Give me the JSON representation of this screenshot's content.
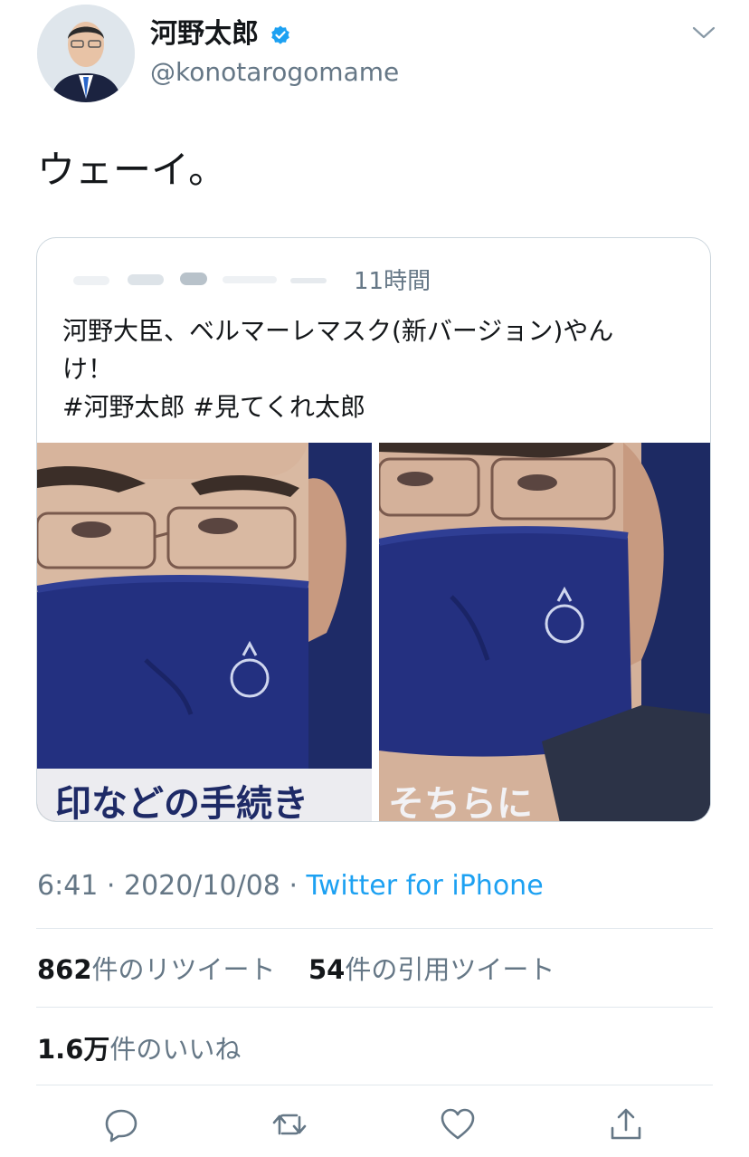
{
  "author": {
    "display_name": "河野太郎",
    "handle": "@konotarogomame",
    "verified": true,
    "avatar_icon": "profile-photo"
  },
  "tweet": {
    "text": "ウェーイ。"
  },
  "quoted_tweet": {
    "time": "11時間",
    "lines": [
      "河野大臣、ベルマーレマスク(新バージョン)やん",
      "け！",
      "#河野太郎 #見てくれ太郎"
    ],
    "images": [
      {
        "caption_overlay": "印などの手続き"
      },
      {
        "caption_overlay": "そちらに"
      }
    ]
  },
  "meta": {
    "time": "6:41",
    "separator": " · ",
    "date": "2020/10/08",
    "source": "Twitter for iPhone"
  },
  "stats": {
    "retweets_count": "862",
    "retweets_label": "件のリツイート",
    "quotes_count": "54",
    "quotes_label": "件の引用ツイート",
    "likes_count": "1.6万",
    "likes_label": "件のいいね"
  },
  "actions": [
    "reply-icon",
    "retweet-icon",
    "like-icon",
    "share-icon"
  ],
  "colors": {
    "link": "#1da1f2",
    "secondary_text": "#657786",
    "mask_navy": "#1e2a66"
  }
}
